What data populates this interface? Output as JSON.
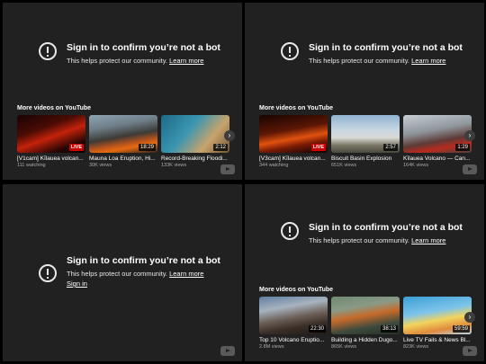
{
  "panels": [
    {
      "title": "Sign in to confirm you’re not a bot",
      "subtitle": "This helps protect our community.",
      "learn_more": "Learn more",
      "more_videos": "More videos on YouTube",
      "videos": [
        {
          "title": "[V1cam] Kīlauea volcan...",
          "meta": "111 watching",
          "badge": "LIVE",
          "badge_type": "live"
        },
        {
          "title": "Mauna Loa Eruption, Hi...",
          "meta": "30K views",
          "badge": "18:29",
          "badge_type": "duration"
        },
        {
          "title": "Record-Breaking Floodi...",
          "meta": "133K views",
          "badge": "2:12",
          "badge_type": "duration"
        }
      ]
    },
    {
      "title": "Sign in to confirm you’re not a bot",
      "subtitle": "This helps protect our community.",
      "learn_more": "Learn more",
      "more_videos": "More videos on YouTube",
      "videos": [
        {
          "title": "[V3cam] Kīlauea volcan...",
          "meta": "344 watching",
          "badge": "LIVE",
          "badge_type": "live"
        },
        {
          "title": "Biscuit Basin Explosion",
          "meta": "651K views",
          "badge": "2:57",
          "badge_type": "duration"
        },
        {
          "title": "Kīlauea Volcano — Can...",
          "meta": "164K views",
          "badge": "1:29",
          "badge_type": "duration"
        }
      ]
    },
    {
      "title": "Sign in to confirm you’re not a bot",
      "subtitle": "This helps protect our community.",
      "learn_more": "Learn more",
      "sign_in": "Sign in"
    },
    {
      "title": "Sign in to confirm you’re not a bot",
      "subtitle": "This helps protect our community.",
      "learn_more": "Learn more",
      "more_videos": "More videos on YouTube",
      "videos": [
        {
          "title": "Top 10 Volcano Eruptio...",
          "meta": "2.8M views",
          "badge": "22:30",
          "badge_type": "duration"
        },
        {
          "title": "Building a Hidden Dugo...",
          "meta": "865K views",
          "badge": "38:13",
          "badge_type": "duration"
        },
        {
          "title": "Live TV Fails & News Bl...",
          "meta": "823K views",
          "badge": "59:59",
          "badge_type": "duration"
        }
      ]
    }
  ],
  "colors": {
    "panel_background": "#212121",
    "page_background": "#000000",
    "live_badge": "#cc0000"
  },
  "icons": [
    "alert-circle-icon",
    "chevron-right-icon",
    "youtube-logo-icon"
  ]
}
